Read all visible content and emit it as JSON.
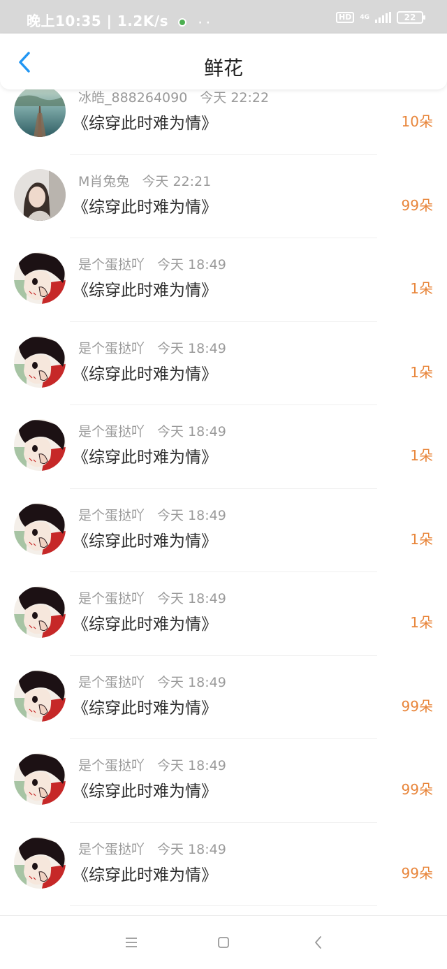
{
  "status_bar": {
    "time_speed": "晚上10:35 | 1.2K/s",
    "extra": "· ·",
    "hd": "HD",
    "network": "4G",
    "battery": "22"
  },
  "header": {
    "title": "鲜花"
  },
  "entries": [
    {
      "user": "冰皓_888264090",
      "time": "今天 22:22",
      "book": "《综穿此时难为情》",
      "count": "10朵",
      "avatar": "lake-avatar"
    },
    {
      "user": "M肖兔兔",
      "time": "今天 22:21",
      "book": "《综穿此时难为情》",
      "count": "99朵",
      "avatar": "girl-avatar"
    },
    {
      "user": "是个蛋挞吖",
      "time": "今天 18:49",
      "book": "《综穿此时难为情》",
      "count": "1朵",
      "avatar": "anime-avatar"
    },
    {
      "user": "是个蛋挞吖",
      "time": "今天 18:49",
      "book": "《综穿此时难为情》",
      "count": "1朵",
      "avatar": "anime-avatar"
    },
    {
      "user": "是个蛋挞吖",
      "time": "今天 18:49",
      "book": "《综穿此时难为情》",
      "count": "1朵",
      "avatar": "anime-avatar"
    },
    {
      "user": "是个蛋挞吖",
      "time": "今天 18:49",
      "book": "《综穿此时难为情》",
      "count": "1朵",
      "avatar": "anime-avatar"
    },
    {
      "user": "是个蛋挞吖",
      "time": "今天 18:49",
      "book": "《综穿此时难为情》",
      "count": "1朵",
      "avatar": "anime-avatar"
    },
    {
      "user": "是个蛋挞吖",
      "time": "今天 18:49",
      "book": "《综穿此时难为情》",
      "count": "99朵",
      "avatar": "anime-avatar"
    },
    {
      "user": "是个蛋挞吖",
      "time": "今天 18:49",
      "book": "《综穿此时难为情》",
      "count": "99朵",
      "avatar": "anime-avatar"
    },
    {
      "user": "是个蛋挞吖",
      "time": "今天 18:49",
      "book": "《综穿此时难为情》",
      "count": "99朵",
      "avatar": "anime-avatar"
    }
  ],
  "colors": {
    "accent": "#2196f3",
    "count": "#e8853a",
    "status_bar": "#d8d8d8"
  },
  "bottom_nav": {
    "menu_icon": "menu-icon",
    "home_icon": "home-icon",
    "back_icon": "back-icon"
  }
}
